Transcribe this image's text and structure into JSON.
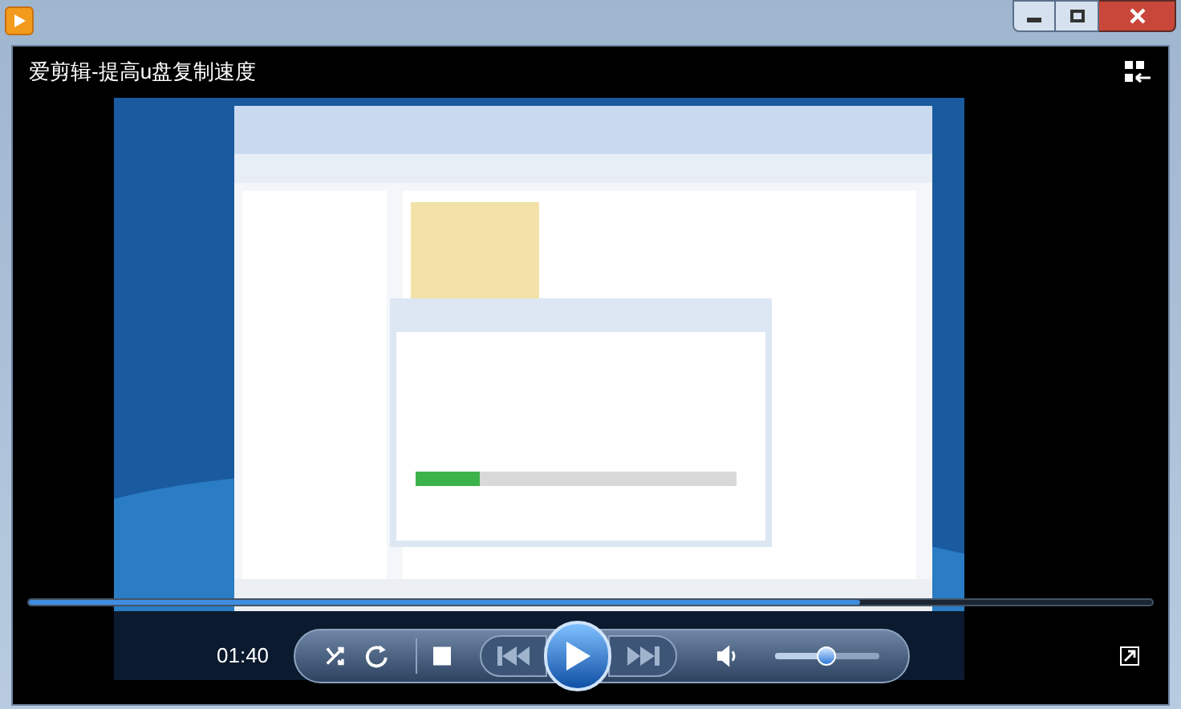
{
  "window": {
    "title": "爱剪辑-提高u盘复制速度"
  },
  "seek": {
    "level": 0.74
  },
  "time": "01:40",
  "volume": {
    "level": 0.5
  }
}
